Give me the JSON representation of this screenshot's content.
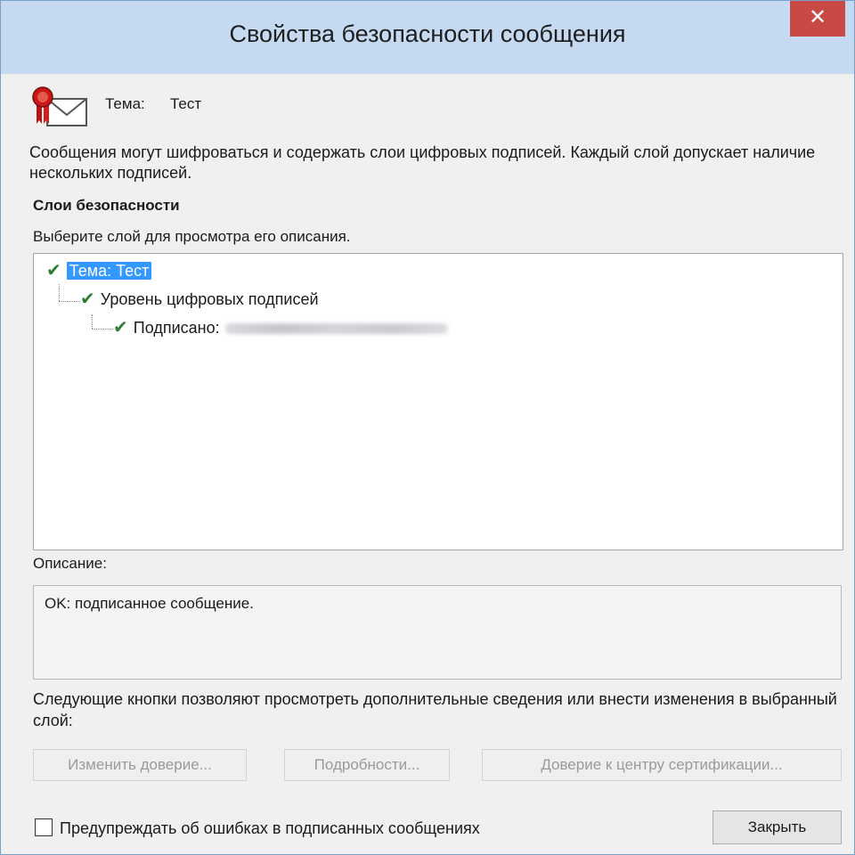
{
  "window": {
    "title": "Свойства безопасности сообщения",
    "close_glyph": "✕"
  },
  "subject": {
    "label": "Тема:",
    "value": "Тест",
    "icon": "signed-envelope-icon"
  },
  "intro_text": "Сообщения могут шифроваться и содержать слои цифровых подписей. Каждый слой допускает наличие нескольких подписей.",
  "layers": {
    "heading": "Слои безопасности",
    "hint": "Выберите слой для просмотра его описания.",
    "tree": [
      {
        "label": "Тема: Тест",
        "selected": true,
        "status": "valid"
      },
      {
        "label": "Уровень цифровых подписей",
        "selected": false,
        "status": "valid"
      },
      {
        "label": "Подписано:",
        "selected": false,
        "status": "valid"
      }
    ]
  },
  "description": {
    "label": "Описание:",
    "text": "OK: подписанное сообщение."
  },
  "buttons_hint": "Следующие кнопки позволяют просмотреть дополнительные сведения или внести изменения в выбранный слой:",
  "buttons": {
    "edit_trust": "Изменить доверие...",
    "details": "Подробности...",
    "trust_ca": "Доверие к центру сертификации...",
    "close": "Закрыть"
  },
  "warn_checkbox": {
    "label": "Предупреждать об ошибках в подписанных сообщениях",
    "checked": false
  },
  "colors": {
    "check": "#2e7d32",
    "selection": "#3399ff",
    "close_button": "#c94a44",
    "titlebar": "#c5daf0"
  }
}
